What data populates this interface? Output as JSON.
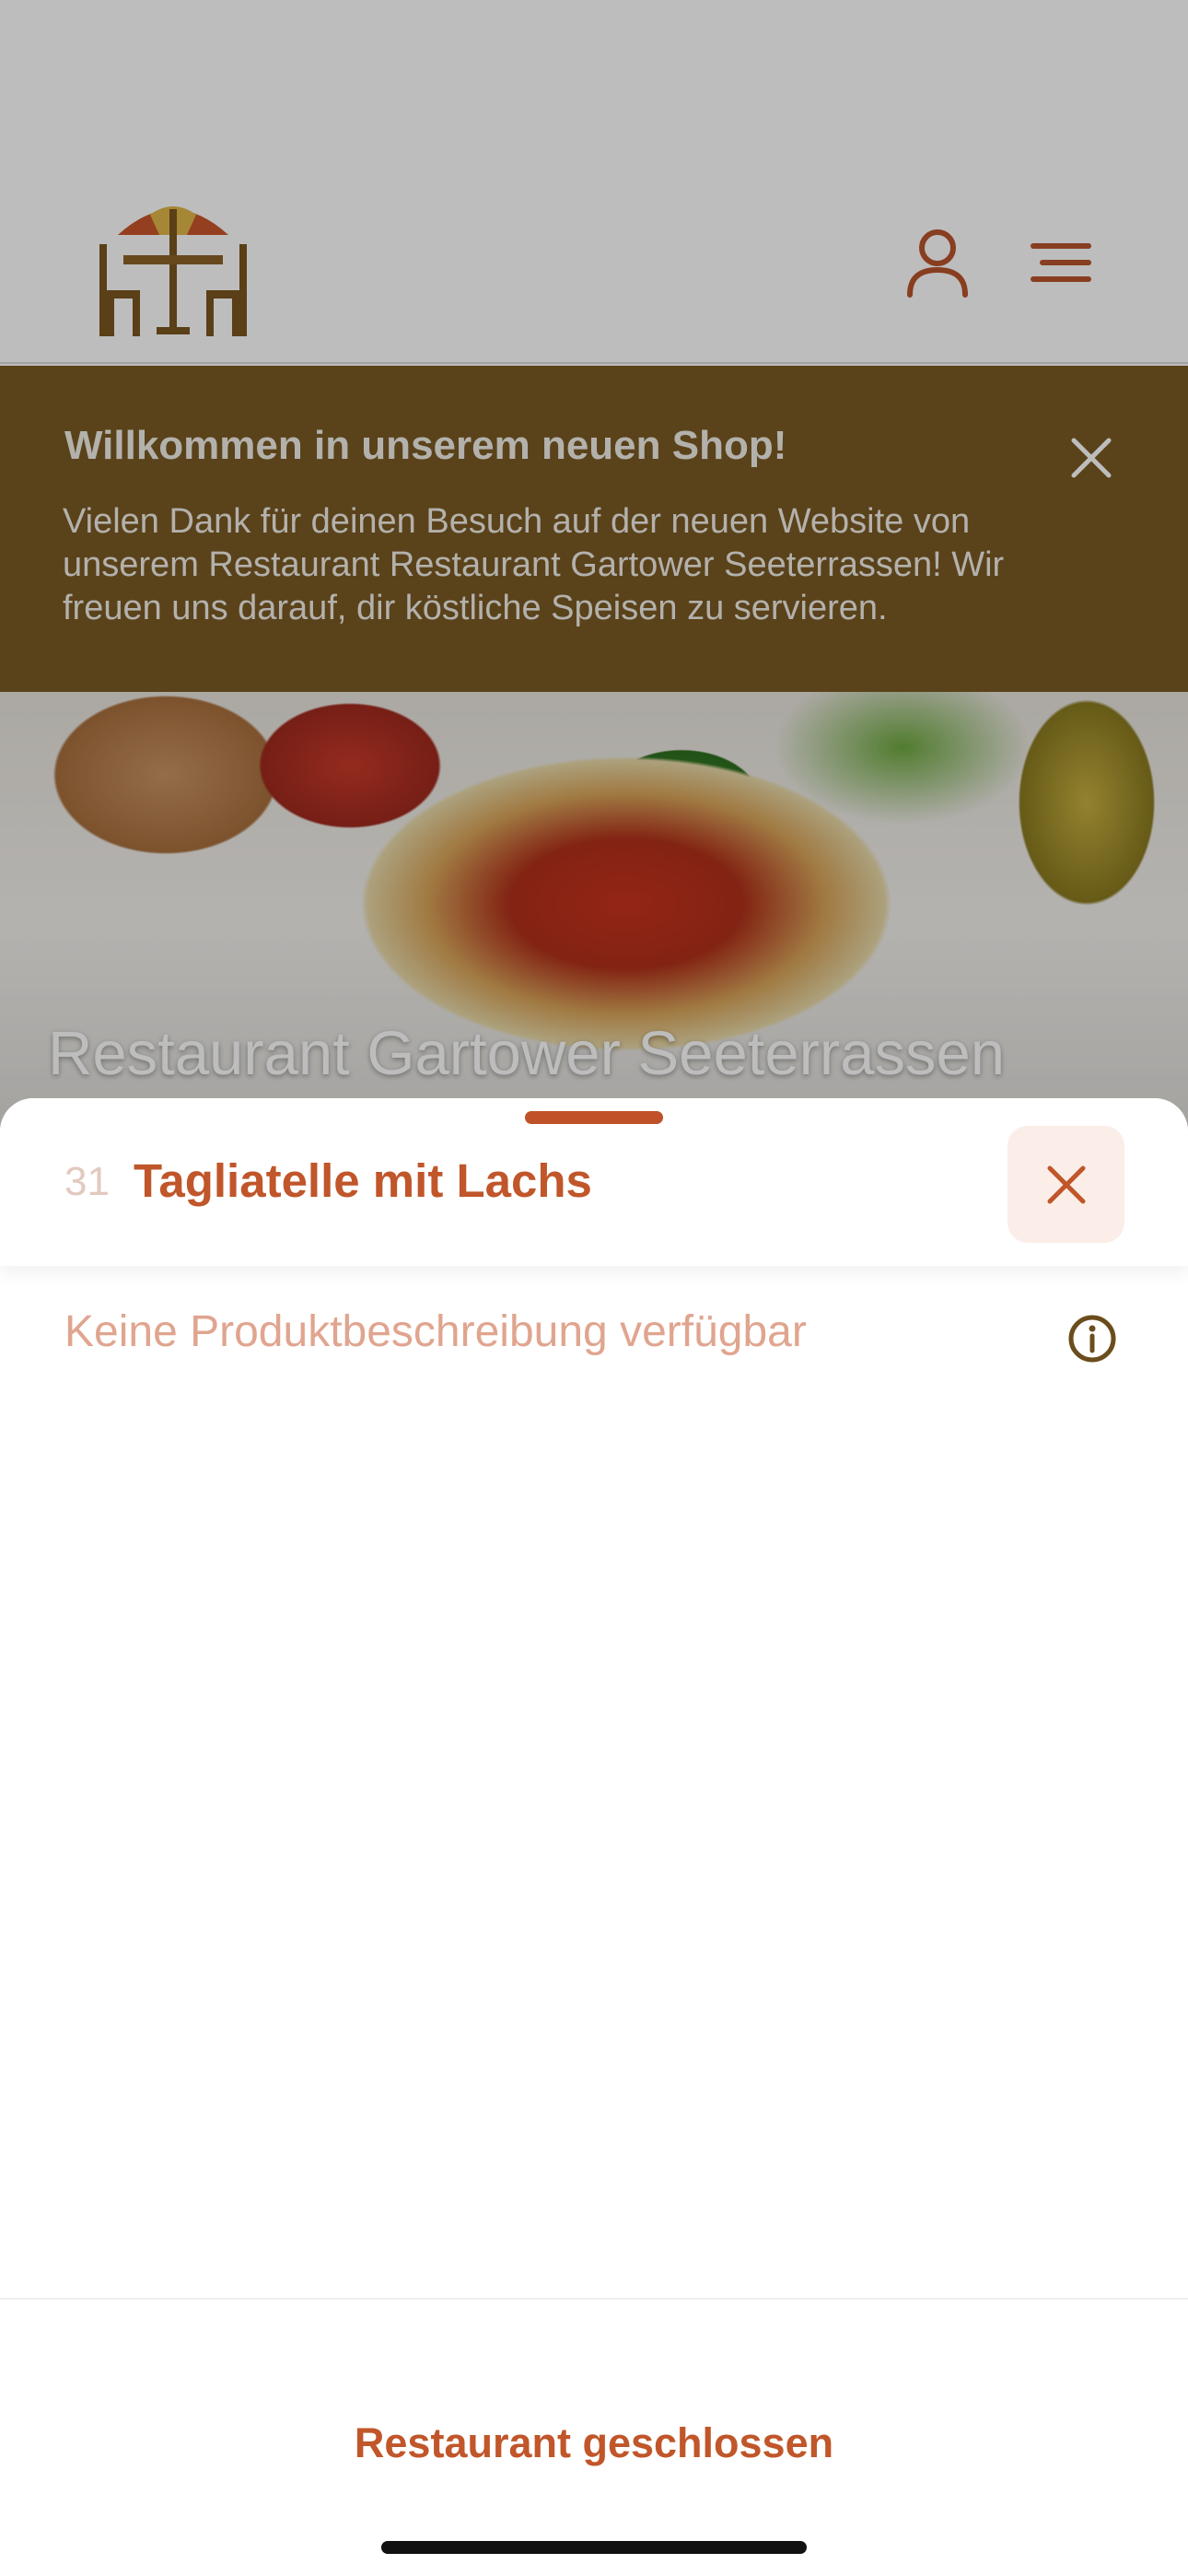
{
  "header": {
    "logo_icon": "restaurant-table-umbrella-icon",
    "user_icon": "user-icon",
    "menu_icon": "hamburger-menu-icon"
  },
  "banner": {
    "title": "Willkommen in unserem neuen Shop!",
    "text": "Vielen Dank für deinen Besuch auf der neuen Website von unserem Restaurant Restaurant Gartower Seeterrassen! Wir freuen uns darauf, dir köstliche Speisen zu servieren.",
    "close_icon": "close-icon",
    "background_color": "#7a5a24"
  },
  "hero": {
    "title": "Restaurant Gartower Seeterrassen"
  },
  "product_sheet": {
    "item_number": "31",
    "item_name": "Tagliatelle mit Lachs",
    "close_icon": "close-icon",
    "description": "Keine Produktbeschreibung verfügbar",
    "info_icon": "info-icon",
    "accent_color": "#c0562a"
  },
  "footer": {
    "status": "Restaurant geschlossen"
  }
}
